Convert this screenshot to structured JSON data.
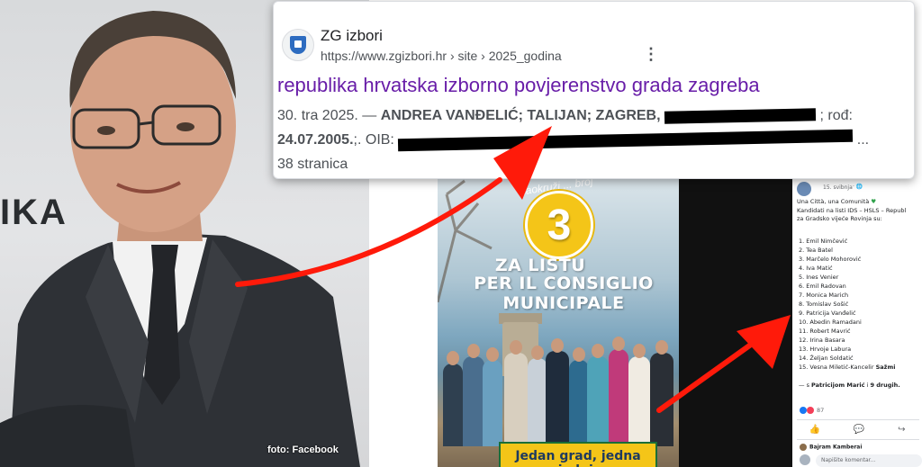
{
  "photo": {
    "partial_word": "IKA",
    "credit": "foto: Facebook"
  },
  "search_result": {
    "site_name": "ZG izbori",
    "url": "https://www.zgizbori.hr › site › 2025_godina",
    "title": "republika hrvatska izborno povjerenstvo grada zagreba",
    "snippet_date": "30. tra 2025. —",
    "snippet_bold_1": "ANDREA VANĐELIĆ; TALIJAN; ZAGREB,",
    "snippet_tail_1": "; rođ:",
    "snippet_bold_2": "24.07.2005.",
    "snippet_mid_2": ";. OIB:",
    "snippet_tail_2": "...",
    "pages": "38 stranica",
    "menu_glyph": "⋮"
  },
  "poster": {
    "arc_text": "Zaokruži ... broj",
    "number": "3",
    "line1": "ZA LISTU",
    "line2": "PER IL CONSIGLIO MUNICIPALE",
    "footer": "Jedan grad, jedna zajednica."
  },
  "facebook_post": {
    "date": "15. svibnja",
    "globe": "· 🌐",
    "line1": "Una Città, una Comunità",
    "line2": "Kandidati na listi IDS – HSLS – Republ",
    "line3": "za Gradsko vijeće Rovinja su:",
    "candidates": [
      "1. Emil Nimčević",
      "2. Tea Batel",
      "3. Marčelo Mohorović",
      "4. Iva Matić",
      "5. Ines Venier",
      "6. Emil Radovan",
      "7. Monica Marich",
      "8. Tomislav Sošić",
      "9. Patricija Vanđelić",
      "10. Abedin Ramadani",
      "11. Robert Mavrić",
      "12. Irina Basara",
      "13. Hrvoje Labura",
      "14. Željan Soldatić",
      "15. Vesna Miletić-Kancelir"
    ],
    "last_suffix": "Sažmi",
    "with_prefix": "— s",
    "with_name": "Patricijom Marić",
    "with_and": "i",
    "with_others": "9 drugih.",
    "reaction_count": "87",
    "commenter": "Bajram Kamberai",
    "comment_placeholder": "Napišite komentar..."
  },
  "colors": {
    "title_link": "#681da8",
    "arrow": "#ff1a0a",
    "badge": "#f4c518"
  }
}
